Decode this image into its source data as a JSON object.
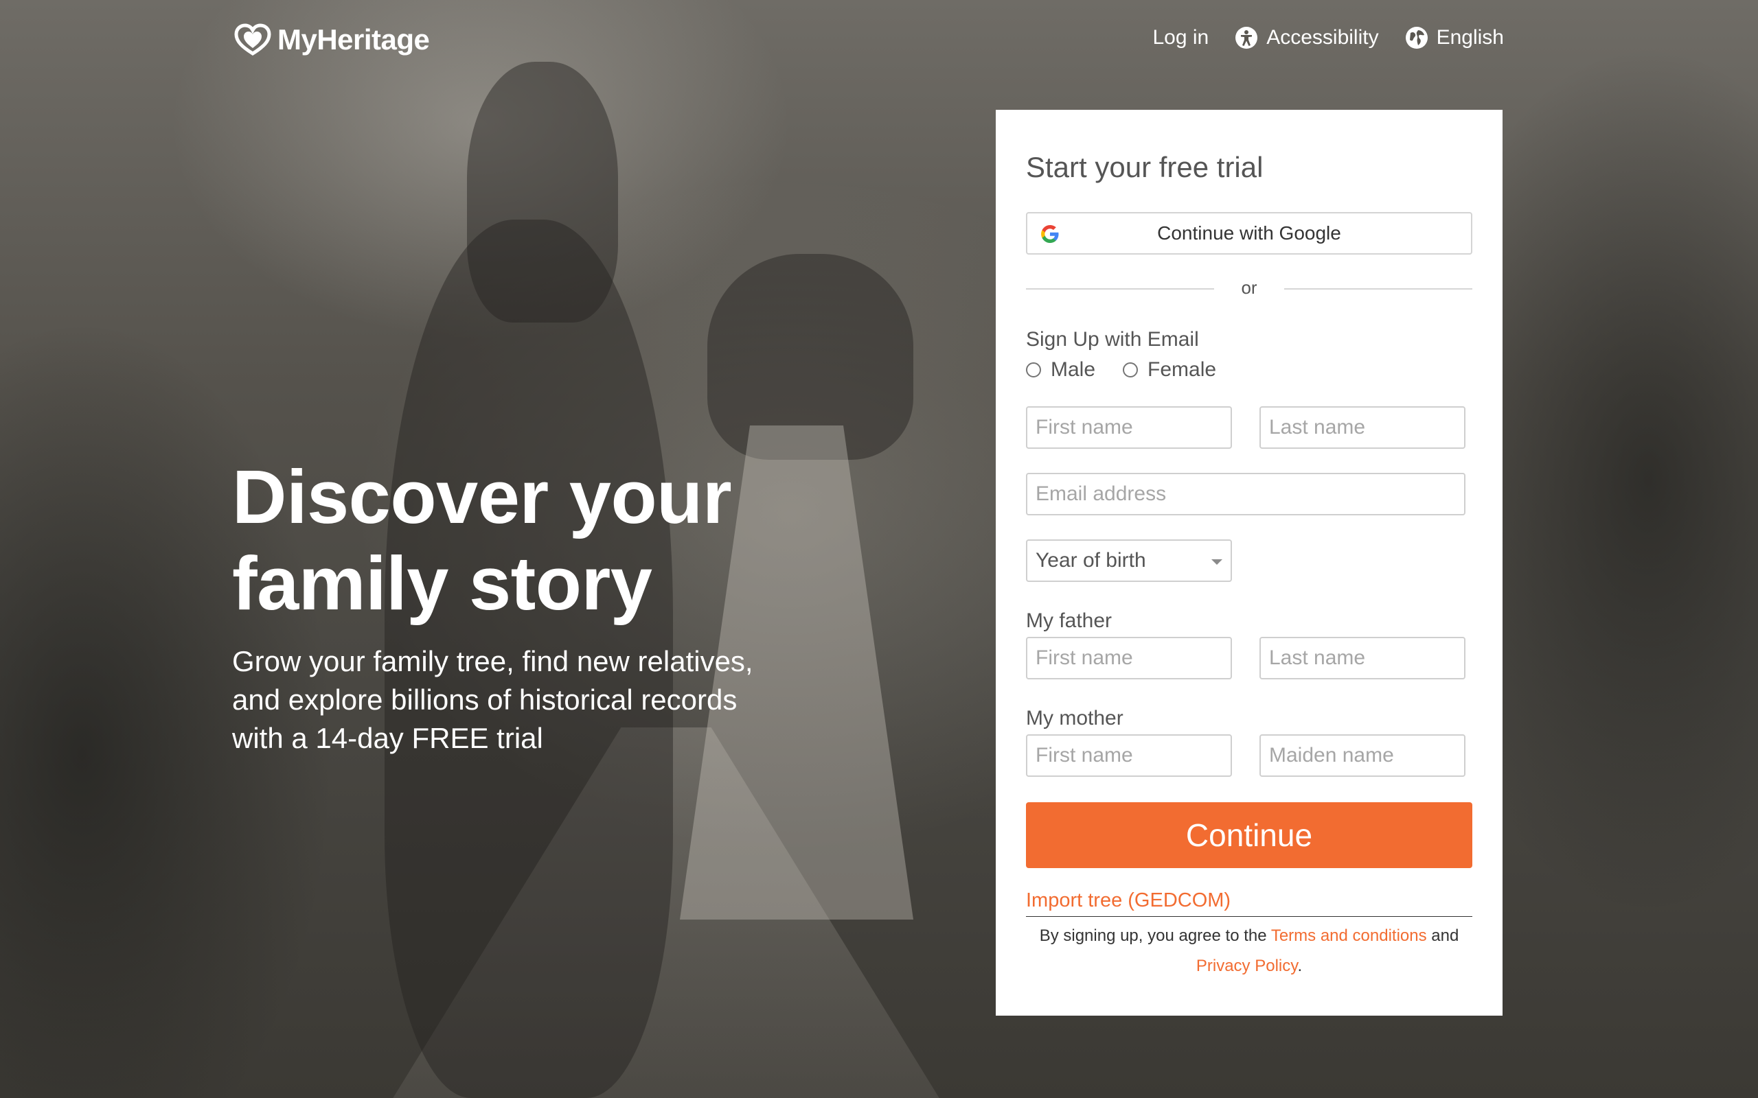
{
  "header": {
    "logo_text": "MyHeritage",
    "nav": {
      "login": "Log in",
      "accessibility": "Accessibility",
      "language": "English"
    }
  },
  "hero": {
    "title_line1": "Discover your",
    "title_line2": "family story",
    "subtitle_line1": "Grow your family tree, find new relatives,",
    "subtitle_line2": "and explore billions of historical records",
    "subtitle_line3": "with a 14-day FREE trial"
  },
  "signup": {
    "title": "Start your free trial",
    "google_button": "Continue with Google",
    "divider": "or",
    "email_section": "Sign Up with Email",
    "gender": {
      "male": "Male",
      "female": "Female"
    },
    "first_name_placeholder": "First name",
    "last_name_placeholder": "Last name",
    "email_placeholder": "Email address",
    "year_of_birth": "Year of birth",
    "father": {
      "label": "My father",
      "first_placeholder": "First name",
      "last_placeholder": "Last name"
    },
    "mother": {
      "label": "My mother",
      "first_placeholder": "First name",
      "maiden_placeholder": "Maiden name"
    },
    "continue_button": "Continue",
    "import_link": "Import tree (GEDCOM)",
    "terms": {
      "prefix": "By signing up, you agree to the",
      "terms_link": "Terms and conditions",
      "and": "and",
      "privacy_link": "Privacy Policy",
      "suffix": "."
    }
  },
  "colors": {
    "accent": "#f26c31",
    "card_bg": "#ffffff",
    "text_muted": "#555555"
  },
  "icons": {
    "logo": "myheritage-logo-icon",
    "accessibility": "accessibility-icon",
    "language": "globe-icon",
    "google": "google-icon",
    "select": "chevron-down-icon"
  }
}
